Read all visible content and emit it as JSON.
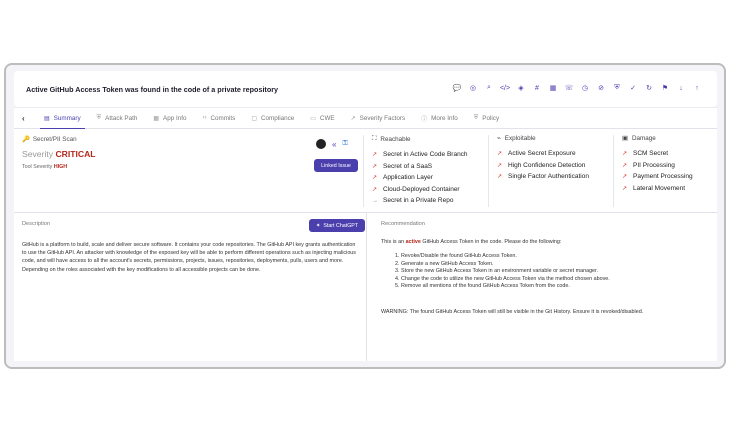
{
  "title": "Active GitHub Access Token was found in the code of a private repository",
  "actions": [
    "chat-icon",
    "target-icon",
    "search-icon",
    "code-icon",
    "diamond-icon",
    "slack-icon",
    "grid-icon",
    "phone-icon",
    "clock-icon",
    "eye-off-icon",
    "shield-icon",
    "shield-check-icon",
    "refresh-icon",
    "flag-icon",
    "arrow-down-icon",
    "arrow-up-icon"
  ],
  "tabs": [
    {
      "label": "Summary",
      "icon": "▤",
      "active": true
    },
    {
      "label": "Attack Path",
      "icon": "⛨"
    },
    {
      "label": "App Info",
      "icon": "▦"
    },
    {
      "label": "Commits",
      "icon": "‹›"
    },
    {
      "label": "Compliance",
      "icon": "▢"
    },
    {
      "label": "CWE",
      "icon": "▭"
    },
    {
      "label": "Severity Factors",
      "icon": "↗"
    },
    {
      "label": "More Info",
      "icon": "ⓘ"
    },
    {
      "label": "Policy",
      "icon": "⛨"
    }
  ],
  "summary": {
    "scan_type": "Secret/PII Scan",
    "severity_label": "Severity",
    "severity": "CRITICAL",
    "tool_severity_label": "Tool Severity",
    "tool_severity": "HIGH",
    "linked_issue": "Linked Issue"
  },
  "columns": {
    "reachable": {
      "title": "Reachable",
      "items": [
        "Secret in Active Code Branch",
        "Secret of a SaaS",
        "Application Layer",
        "Cloud-Deployed Container",
        "Secret in a Private Repo"
      ]
    },
    "exploitable": {
      "title": "Exploitable",
      "items": [
        "Active Secret Exposure",
        "High Confidence Detection",
        "Single Factor Authentication"
      ]
    },
    "damage": {
      "title": "Damage",
      "items": [
        "SCM Secret",
        "PII Processing",
        "Payment Processing",
        "Lateral Movement"
      ]
    }
  },
  "description": {
    "label": "Description",
    "button": "Start ChatGPT",
    "text": "GitHub is a platform to build, scale and deliver secure software. It contains your code repositories. The GitHub API key grants authentication to use the GitHub API. An attacker with knowledge of the exposed key will be able to perform different operations such as injecting malicious code, and will have access to all the account's secrets, permissions, projects, issues, repositories, deployments, pulls, users and more. Depending on the roles associated with the key modifications to all accessible projects can be done."
  },
  "recommendation": {
    "label": "Recommendation",
    "intro_prefix": "This is an",
    "intro_bold": "active",
    "intro_suffix": "GitHub Access Token in the code. Please do the following:",
    "steps": [
      "1. Revoke/Disable the found GitHub Access Token.",
      "2. Generate a new GitHub Access Token.",
      "3. Store the new GitHub Access Token in an environment variable or secret manager.",
      "4. Change the code to utilize the new GitHub Access Token via the method chosen above.",
      "5. Remove all mentions of the found GitHub Access Token from the code."
    ],
    "warning": "WARNING: The found GitHub Access Token will still be visible in the Git History. Ensure it is revoked/disabled."
  }
}
